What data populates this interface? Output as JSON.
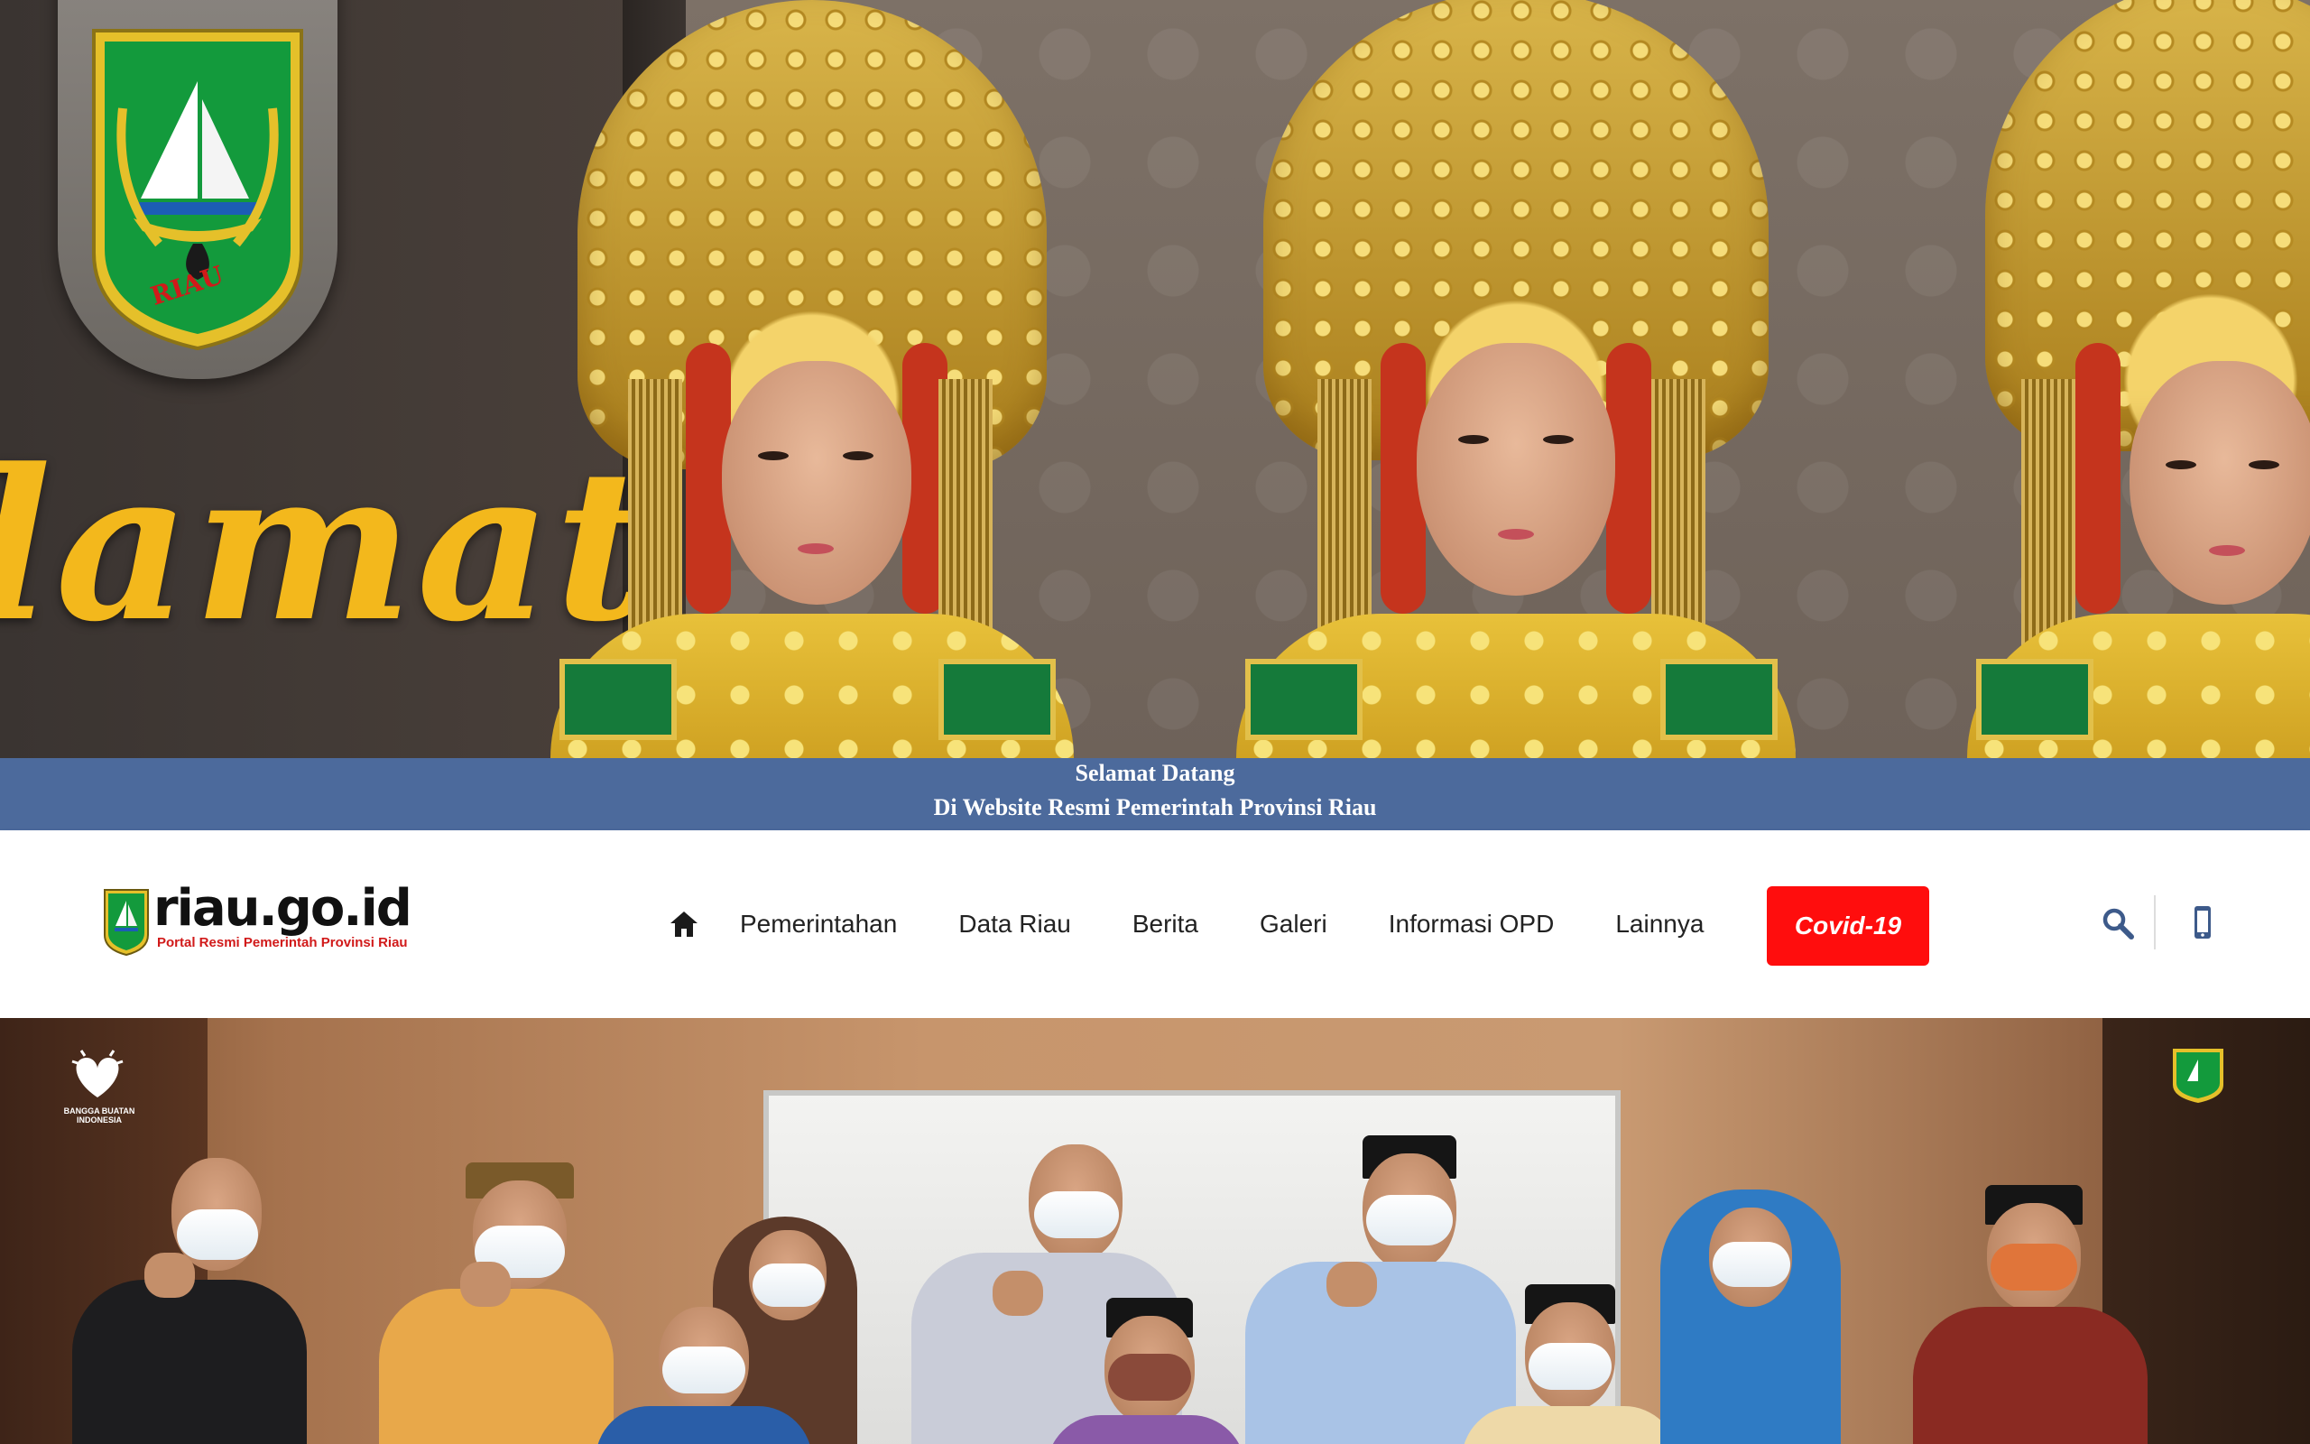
{
  "hero": {
    "banner_script": "lamat",
    "emblem_label": "RIAU"
  },
  "welcome": {
    "line1": "Selamat Datang",
    "line2": "Di Website Resmi Pemerintah Provinsi Riau"
  },
  "navbar": {
    "logo": {
      "title": "riau.go.id",
      "subtitle": "Portal Resmi Pemerintah Provinsi Riau"
    },
    "home_icon": "home-icon",
    "items": [
      {
        "label": "Pemerintahan"
      },
      {
        "label": "Data Riau"
      },
      {
        "label": "Berita"
      },
      {
        "label": "Galeri"
      },
      {
        "label": "Informasi OPD"
      },
      {
        "label": "Lainnya"
      }
    ],
    "covid_button": "Covid-19",
    "search_icon": "search-icon",
    "mobile_icon": "mobile-phone-icon"
  },
  "news_photo": {
    "left_logo_text": "BANGGA BUATAN INDONESIA"
  },
  "colors": {
    "welcome_strip": "#4c6a9c",
    "covid_button": "#ff0d0d",
    "icon_blue": "#3d5a8a",
    "logo_red": "#d11a1a",
    "hero_gold": "#f3b81c"
  }
}
